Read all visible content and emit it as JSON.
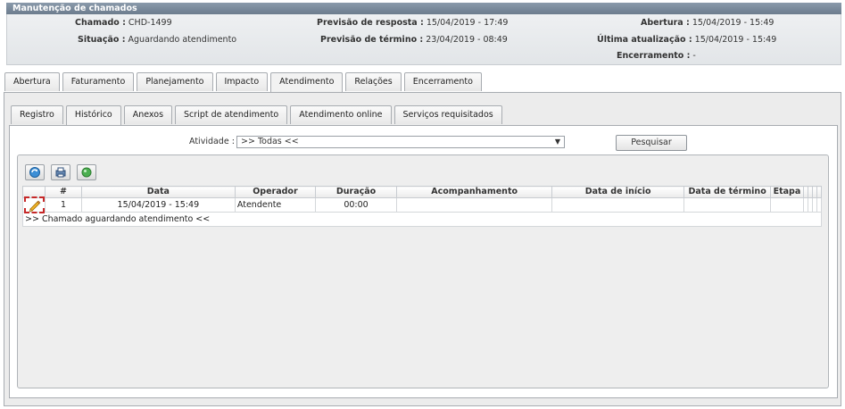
{
  "window": {
    "title": "Manutenção de chamados"
  },
  "header": {
    "chamado_label": "Chamado :",
    "chamado_value": "CHD-1499",
    "situacao_label": "Situação :",
    "situacao_value": "Aguardando atendimento",
    "prev_resposta_label": "Previsão de resposta :",
    "prev_resposta_value": "15/04/2019 - 17:49",
    "prev_termino_label": "Previsão de término :",
    "prev_termino_value": "23/04/2019 - 08:49",
    "abertura_label": "Abertura :",
    "abertura_value": "15/04/2019 - 15:49",
    "ultima_label": "Última atualização :",
    "ultima_value": "15/04/2019 - 15:49",
    "encerramento_label": "Encerramento :",
    "encerramento_value": "-"
  },
  "main_tabs": [
    "Abertura",
    "Faturamento",
    "Planejamento",
    "Impacto",
    "Atendimento",
    "Relações",
    "Encerramento"
  ],
  "main_tab_active": "Atendimento",
  "sub_tabs": [
    "Registro",
    "Histórico",
    "Anexos",
    "Script de atendimento",
    "Atendimento online",
    "Serviços requisitados"
  ],
  "sub_tab_active": "Histórico",
  "filter": {
    "atividade_label": "Atividade :",
    "atividade_value": ">> Todas <<",
    "search_button": "Pesquisar"
  },
  "toolbar": {
    "icons": [
      "refresh-icon",
      "print-icon",
      "status-icon"
    ]
  },
  "table": {
    "columns": [
      "#",
      "Data",
      "Operador",
      "Duração",
      "Acompanhamento",
      "Data de início",
      "Data de término",
      "Etapa"
    ],
    "rows": [
      {
        "num": "1",
        "data": "15/04/2019 - 15:49",
        "operador": "Atendente",
        "duracao": "00:00",
        "acompanhamento": "",
        "inicio": "",
        "termino": "",
        "etapa": ""
      }
    ],
    "message": ">> Chamado aguardando atendimento <<"
  }
}
